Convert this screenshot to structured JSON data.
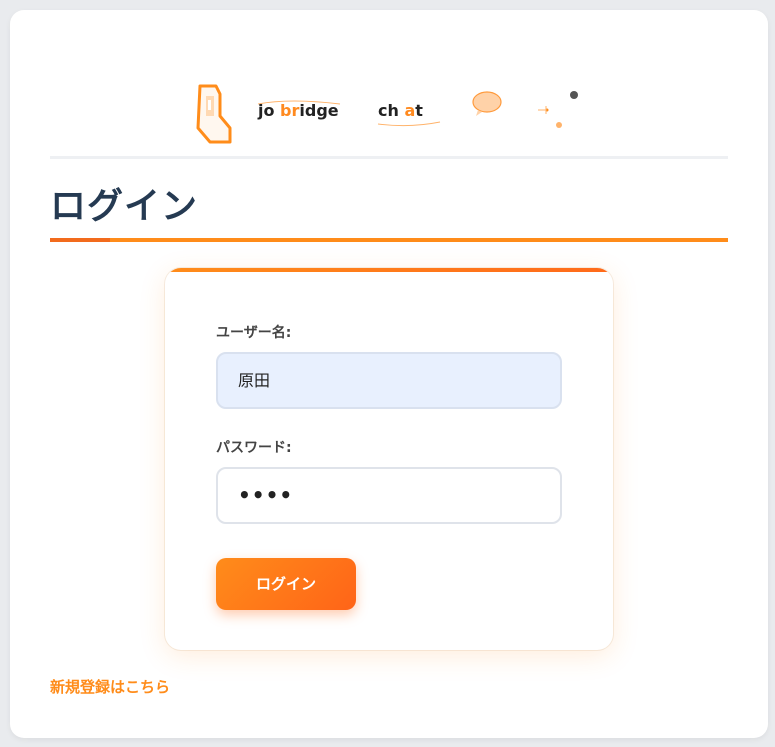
{
  "logo": {
    "word1_parts": [
      "jo ",
      "br",
      "idge"
    ],
    "word2_parts": [
      "ch ",
      "a",
      "t"
    ],
    "accent_color": "#ff8a1f",
    "icons": [
      "phone-icon",
      "speech-bubble-icon",
      "network-dots-icon"
    ]
  },
  "page": {
    "title": "ログイン"
  },
  "form": {
    "username_label": "ユーザー名:",
    "username_value": "原田",
    "password_label": "パスワード:",
    "password_value": "••••",
    "submit_label": "ログイン"
  },
  "links": {
    "register": "新規登録はこちら"
  },
  "colors": {
    "accent": "#ff8c1a",
    "title": "#253a52",
    "input_filled_bg": "#e8f0fe"
  }
}
